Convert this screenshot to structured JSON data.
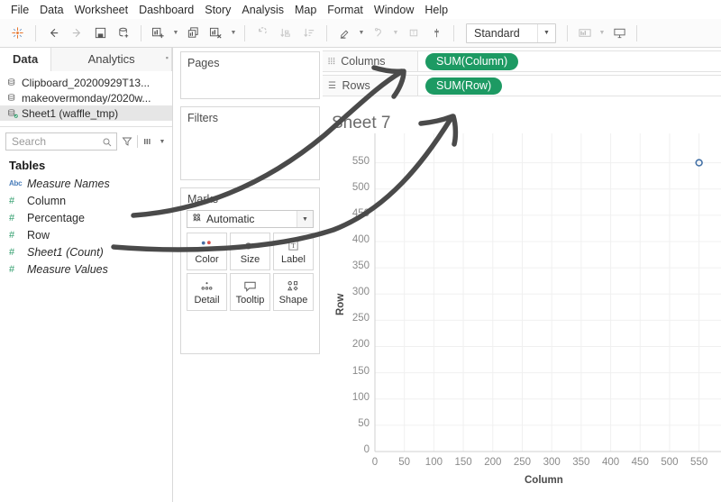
{
  "menubar": {
    "items": [
      {
        "label": "File"
      },
      {
        "label": "Data"
      },
      {
        "label": "Worksheet"
      },
      {
        "label": "Dashboard"
      },
      {
        "label": "Story"
      },
      {
        "label": "Analysis"
      },
      {
        "label": "Map"
      },
      {
        "label": "Format"
      },
      {
        "label": "Window"
      },
      {
        "label": "Help"
      }
    ]
  },
  "toolbar": {
    "fit_value": "Standard",
    "icons": [
      "tableau-logo-icon",
      "back-arrow-icon",
      "forward-arrow-icon",
      "save-icon",
      "new-data-source-icon",
      "new-worksheet-icon",
      "duplicate-sheet-icon",
      "clear-sheet-icon",
      "swap-rows-columns-icon",
      "sort-ascending-icon",
      "sort-descending-icon",
      "highlight-icon",
      "group-members-icon",
      "show-labels-icon",
      "fix-axes-icon",
      "fit-selector",
      "show-hide-cards-icon",
      "presentation-mode-icon"
    ]
  },
  "left_pane": {
    "tabs": [
      {
        "label": "Data",
        "active": true
      },
      {
        "label": "Analytics",
        "active": false
      }
    ],
    "data_sources": [
      {
        "label": "Clipboard_20200929T13...",
        "selected": false,
        "icon": "data-source-icon"
      },
      {
        "label": "makeovermonday/2020w...",
        "selected": false,
        "icon": "data-source-icon"
      },
      {
        "label": "Sheet1 (waffle_tmp)",
        "selected": true,
        "icon": "data-source-live-icon"
      }
    ],
    "search": {
      "placeholder": "Search",
      "magnifier_icon": "search-icon",
      "filter_icon": "filter-icon",
      "view_icon": "group-by-icon"
    },
    "tables_header": "Tables",
    "fields": [
      {
        "label": "Measure Names",
        "type": "abc",
        "italic": true
      },
      {
        "label": "Column",
        "type": "num",
        "italic": false
      },
      {
        "label": "Percentage",
        "type": "num",
        "italic": false
      },
      {
        "label": "Row",
        "type": "num",
        "italic": false
      },
      {
        "label": "Sheet1 (Count)",
        "type": "num",
        "italic": true
      },
      {
        "label": "Measure Values",
        "type": "num",
        "italic": true
      }
    ]
  },
  "cards": {
    "pages_title": "Pages",
    "filters_title": "Filters",
    "marks_title": "Marks",
    "marks_type": "Automatic",
    "marks_buttons": [
      {
        "label": "Color",
        "icon": "color-icon"
      },
      {
        "label": "Size",
        "icon": "size-icon"
      },
      {
        "label": "Label",
        "icon": "label-icon"
      },
      {
        "label": "Detail",
        "icon": "detail-icon"
      },
      {
        "label": "Tooltip",
        "icon": "tooltip-icon"
      },
      {
        "label": "Shape",
        "icon": "shape-icon"
      }
    ]
  },
  "shelves": {
    "columns_label": "Columns",
    "rows_label": "Rows",
    "columns_pill": "SUM(Column)",
    "rows_pill": "SUM(Row)",
    "pill_color": "#1d9a63"
  },
  "viz": {
    "title": "Sheet 7"
  },
  "chart_data": {
    "type": "scatter",
    "title": "Sheet 7",
    "xlabel": "Column",
    "ylabel": "Row",
    "xlim": [
      0,
      575
    ],
    "ylim": [
      0,
      575
    ],
    "xticks": [
      0,
      50,
      100,
      150,
      200,
      250,
      300,
      350,
      400,
      450,
      500,
      550
    ],
    "yticks": [
      0,
      50,
      100,
      150,
      200,
      250,
      300,
      350,
      400,
      450,
      500,
      550
    ],
    "grid": true,
    "legend": "none",
    "series": [
      {
        "name": "SUM(Row) vs SUM(Column)",
        "color": "#4572a7",
        "marker": "open-circle",
        "points": [
          {
            "x": 550,
            "y": 550
          }
        ]
      }
    ]
  },
  "annotations": {
    "color": "#4a4a4a",
    "arrows": [
      {
        "name": "arrow-column-to-columns-shelf",
        "from": "Column field",
        "to": "Columns shelf"
      },
      {
        "name": "arrow-row-to-rows-shelf",
        "from": "Row field",
        "to": "Rows shelf"
      }
    ]
  }
}
